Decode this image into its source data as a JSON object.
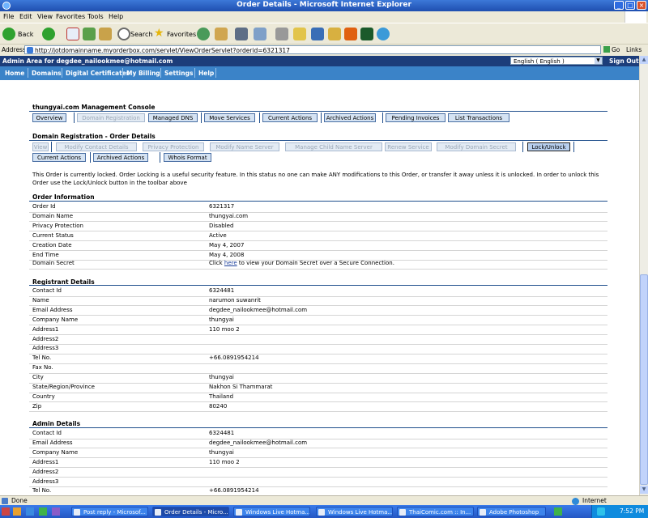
{
  "window": {
    "title": "Order Details - Microsoft Internet Explorer"
  },
  "menu": [
    "File",
    "Edit",
    "View",
    "Favorites",
    "Tools",
    "Help"
  ],
  "toolbar": {
    "back": "Back",
    "search": "Search",
    "favorites": "Favorites"
  },
  "address": {
    "label": "Address",
    "url": "http://jotdomainname.myorderbox.com/servlet/ViewOrderServlet?orderid=6321317",
    "go": "Go",
    "links": "Links"
  },
  "admin": {
    "area": "Admin Area for degdee_nailookmee@hotmail.com",
    "language": "English ( English )",
    "signout": "Sign Out"
  },
  "nav": [
    "Home",
    "Domains",
    "Digital Certificates",
    "My Billing",
    "Settings",
    "Help"
  ],
  "console": {
    "title": "thungyai.com Management Console",
    "buttons": [
      "Overview",
      "Managed DNS",
      "Move Services",
      "Current Actions",
      "Archived Actions",
      "Pending Invoices",
      "List Transactions"
    ]
  },
  "registration": {
    "title": "Domain Registration - Order Details",
    "row1": [
      "View",
      "Modify Contact Details",
      "Privacy Protection",
      "Modify Name Server",
      "Manage Child Name Server",
      "Renew Service",
      "Modify Domain Secret",
      "Lock/Unlock"
    ],
    "row2": [
      "Current Actions",
      "Archived Actions",
      "Whois Format"
    ]
  },
  "notice": "This Order is currently locked. Order Locking is a useful security feature. In this status no one can make ANY modifications to this Order, or transfer it away unless it is unlocked. In order to unlock this Order use the Lock/Unlock button in the toolbar above",
  "order": {
    "title": "Order Information",
    "rows": [
      {
        "label": "Order Id",
        "value": "6321317"
      },
      {
        "label": "Domain Name",
        "value": "thungyai.com"
      },
      {
        "label": "Privacy Protection",
        "value": "Disabled"
      },
      {
        "label": "Current Status",
        "value": "Active"
      },
      {
        "label": "Creation Date",
        "value": "May 4, 2007"
      },
      {
        "label": "End Time",
        "value": "May 4, 2008"
      }
    ],
    "secret": {
      "label": "Domain Secret",
      "pre": "Click ",
      "link": "here",
      "post": " to view your Domain Secret over a Secure Connection."
    }
  },
  "registrant": {
    "title": "Registrant Details",
    "rows": [
      {
        "label": "Contact Id",
        "value": "6324481"
      },
      {
        "label": "Name",
        "value": "narumon suwanrit"
      },
      {
        "label": "Email Address",
        "value": "degdee_nailookmee@hotmail.com"
      },
      {
        "label": "Company Name",
        "value": "thungyai"
      },
      {
        "label": "Address1",
        "value": "110 moo 2"
      },
      {
        "label": "Address2",
        "value": ""
      },
      {
        "label": "Address3",
        "value": ""
      },
      {
        "label": "Tel No.",
        "value": "+66.0891954214"
      },
      {
        "label": "Fax No.",
        "value": ""
      },
      {
        "label": "City",
        "value": "thungyai"
      },
      {
        "label": "State/Region/Province",
        "value": "Nakhon Si Thammarat"
      },
      {
        "label": "Country",
        "value": "Thailand"
      },
      {
        "label": "Zip",
        "value": "80240"
      }
    ]
  },
  "adminDetails": {
    "title": "Admin Details",
    "rows": [
      {
        "label": "Contact Id",
        "value": "6324481"
      },
      {
        "label": "Email Address",
        "value": "degdee_nailookmee@hotmail.com"
      },
      {
        "label": "Company Name",
        "value": "thungyai"
      },
      {
        "label": "Address1",
        "value": "110 moo 2"
      },
      {
        "label": "Address2",
        "value": ""
      },
      {
        "label": "Address3",
        "value": ""
      },
      {
        "label": "Tel No.",
        "value": "+66.0891954214"
      }
    ]
  },
  "status": {
    "left": "Done",
    "zone": "Internet"
  },
  "taskbar": {
    "tasks": [
      "Post reply - Microsof...",
      "Order Details - Micro...",
      "Windows Live Hotma...",
      "Windows Live Hotma...",
      "ThaiComic.com :: In...",
      "Adobe Photoshop"
    ],
    "clock": "7:52 PM"
  }
}
